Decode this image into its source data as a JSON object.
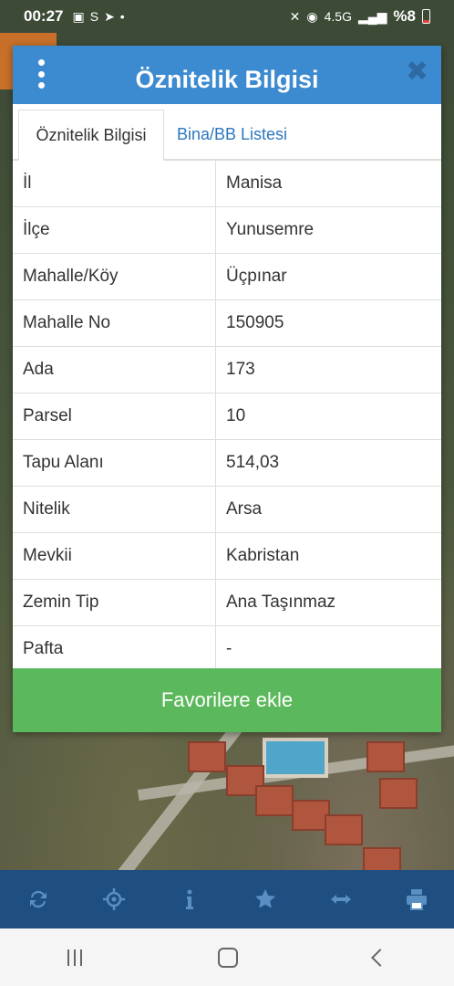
{
  "status_bar": {
    "time": "00:27",
    "network": "4.5G",
    "battery": "%8"
  },
  "dialog": {
    "title": "Öznitelik Bilgisi",
    "tabs": [
      {
        "label": "Öznitelik Bilgisi",
        "active": true
      },
      {
        "label": "Bina/BB Listesi",
        "active": false
      }
    ],
    "rows": [
      {
        "key": "İl",
        "value": "Manisa"
      },
      {
        "key": "İlçe",
        "value": "Yunusemre"
      },
      {
        "key": "Mahalle/Köy",
        "value": "Üçpınar"
      },
      {
        "key": "Mahalle No",
        "value": "150905"
      },
      {
        "key": "Ada",
        "value": "173"
      },
      {
        "key": "Parsel",
        "value": "10"
      },
      {
        "key": "Tapu Alanı",
        "value": "514,03"
      },
      {
        "key": "Nitelik",
        "value": "Arsa"
      },
      {
        "key": "Mevkii",
        "value": "Kabristan"
      },
      {
        "key": "Zemin Tip",
        "value": "Ana Taşınmaz"
      },
      {
        "key": "Pafta",
        "value": "-"
      }
    ],
    "favorite_button": "Favorilere ekle"
  },
  "toolbar": {
    "items": [
      "refresh-icon",
      "locate-icon",
      "info-icon",
      "star-icon",
      "measure-icon",
      "print-icon"
    ]
  },
  "colors": {
    "header": "#3c8ad0",
    "favorite": "#5cb85c",
    "toolbar": "#1f4f80",
    "tab_link": "#2d77c0"
  }
}
